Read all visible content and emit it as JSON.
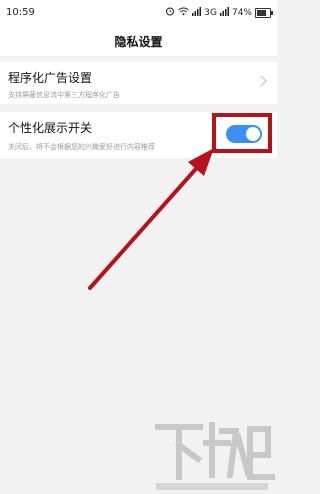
{
  "status_bar": {
    "time": "10:59",
    "network": "3G",
    "battery": "74%",
    "battery_level": 0.74
  },
  "header": {
    "title": "隐私设置"
  },
  "settings": [
    {
      "title": "程序化广告设置",
      "subtitle": "支持屏蔽信息流中第三方程序化广告",
      "control": "chevron-right-icon"
    },
    {
      "title": "个性化展示开关",
      "subtitle": "关闭后，将不会根据您的兴趣爱好进行内容推荐",
      "control": "toggle",
      "toggle_on": true
    }
  ],
  "colors": {
    "toggle_on": "#3d8ff5",
    "annotation_red": "#b5121b",
    "background": "#f2f2f2"
  }
}
